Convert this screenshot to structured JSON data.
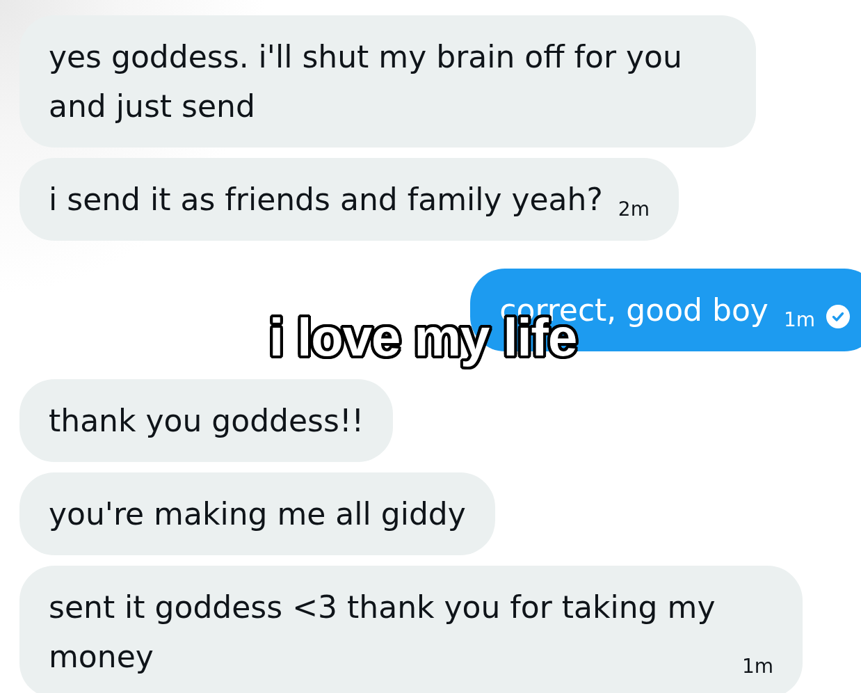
{
  "messages": [
    {
      "kind": "received",
      "text": "yes goddess. i'll shut my brain off for you and just send",
      "read": false
    },
    {
      "kind": "received",
      "text": "i send it as friends and family yeah?",
      "time": "2m",
      "read": false
    },
    {
      "kind": "sent",
      "text": "correct, good boy",
      "time": "1m",
      "read": true
    },
    {
      "kind": "received",
      "text": "thank you goddess!!",
      "read": false
    },
    {
      "kind": "received",
      "text": "you're making me all giddy",
      "read": false
    },
    {
      "kind": "received",
      "text": "sent it goddess <3 thank you for taking my money",
      "time": "1m",
      "read": false
    }
  ],
  "caption": {
    "text": "i love my life"
  }
}
